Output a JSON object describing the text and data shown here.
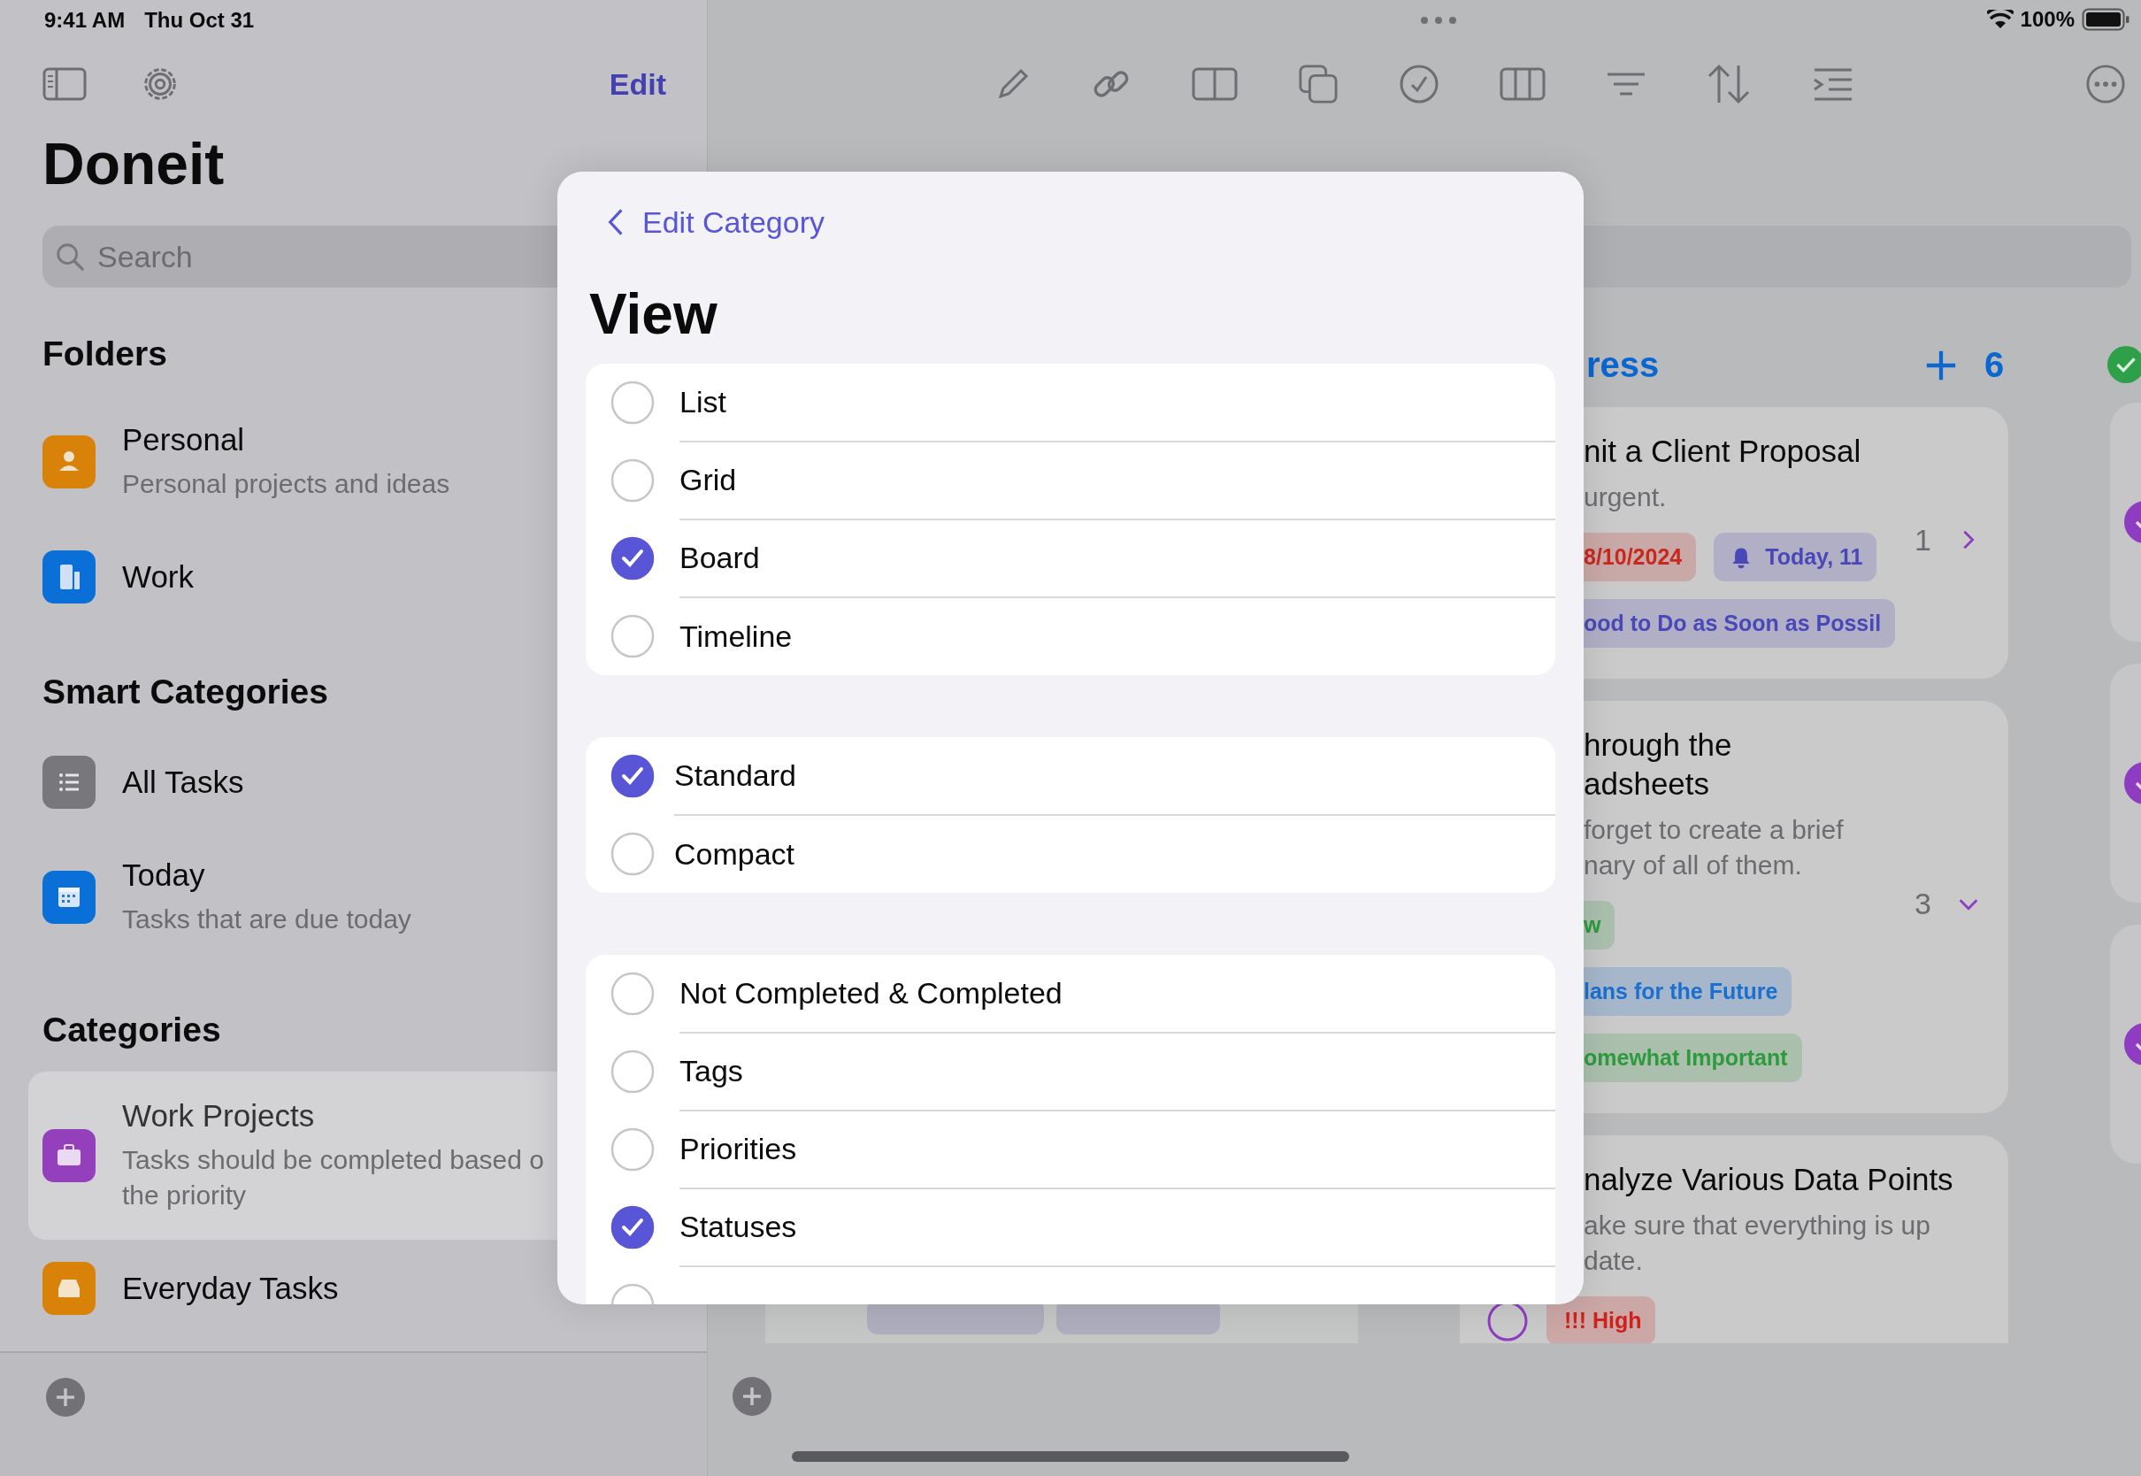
{
  "status_bar": {
    "time": "9:41 AM",
    "date": "Thu Oct 31",
    "battery": "100%"
  },
  "sidebar": {
    "edit": "Edit",
    "title": "Doneit",
    "search_placeholder": "Search",
    "sections": [
      {
        "title": "Folders",
        "items": [
          {
            "kind": "person",
            "name": "Personal",
            "subtitle": "Personal projects and ideas",
            "color": "#d9820a",
            "selected": false
          },
          {
            "kind": "building",
            "name": "Work",
            "color": "#0a6fd6",
            "selected": false
          }
        ]
      },
      {
        "title": "Smart Categories",
        "items": [
          {
            "kind": "list",
            "name": "All Tasks",
            "color": "#77777c",
            "selected": false
          },
          {
            "kind": "calendar",
            "name": "Today",
            "subtitle": "Tasks that are due today",
            "color": "#0a6fd6",
            "selected": false
          }
        ]
      },
      {
        "title": "Categories",
        "items": [
          {
            "kind": "briefcase",
            "name": "Work Projects",
            "subtitle": "Tasks should be completed based o the priority",
            "color": "#9440bd",
            "selected": true
          },
          {
            "kind": "tray",
            "name": "Everyday Tasks",
            "color": "#d9820a",
            "selected": false
          }
        ]
      }
    ]
  },
  "main": {
    "column": {
      "title": "ress",
      "count": "6",
      "cards": [
        {
          "title_lines": [
            "nit a Client Proposal"
          ],
          "note_lines": [
            "urgent."
          ],
          "count": "1",
          "expanded": false,
          "tags": [
            {
              "kind": "date",
              "text": "8/10/2024",
              "color": "#c8281e"
            },
            {
              "kind": "reminder",
              "text": "Today, 11",
              "color": "#4a48b8"
            },
            {
              "kind": "tag",
              "text": "ood to Do as Soon as Possil",
              "color": "#4a48b8"
            }
          ]
        },
        {
          "title_lines": [
            "hrough the",
            "adsheets"
          ],
          "note_lines": [
            "forget to create a brief",
            "nary of all of them."
          ],
          "count": "3",
          "expanded": true,
          "tags": [
            {
              "kind": "tag",
              "text": "w",
              "color": "#2e9a3e"
            },
            {
              "kind": "tag",
              "text": "lans for the Future",
              "color": "#1a6fd0"
            },
            {
              "kind": "tag",
              "text": "omewhat Important",
              "color": "#2e9a3e"
            }
          ]
        },
        {
          "title_lines": [
            "nalyze Various Data Points"
          ],
          "note_lines": [
            "ake sure that everything is up",
            "date."
          ],
          "status": true,
          "tags": [
            {
              "kind": "tag",
              "text": "!!! High",
              "color": "#d0201a"
            }
          ]
        }
      ]
    },
    "done_column": {
      "cards": [
        {
          "checked": true
        },
        {
          "checked": true
        },
        {
          "checked": true
        }
      ]
    }
  },
  "modal": {
    "back": "Edit Category",
    "title": "View",
    "groups": [
      [
        {
          "label": "List",
          "selected": false
        },
        {
          "label": "Grid",
          "selected": false
        },
        {
          "label": "Board",
          "selected": true
        },
        {
          "label": "Timeline",
          "selected": false
        }
      ],
      [
        {
          "label": "Standard",
          "selected": true
        },
        {
          "label": "Compact",
          "selected": false
        }
      ],
      [
        {
          "label": "Not Completed & Completed",
          "selected": false
        },
        {
          "label": "Tags",
          "selected": false
        },
        {
          "label": "Priorities",
          "selected": false
        },
        {
          "label": "Statuses",
          "selected": true
        },
        {
          "selected": false
        }
      ]
    ]
  }
}
